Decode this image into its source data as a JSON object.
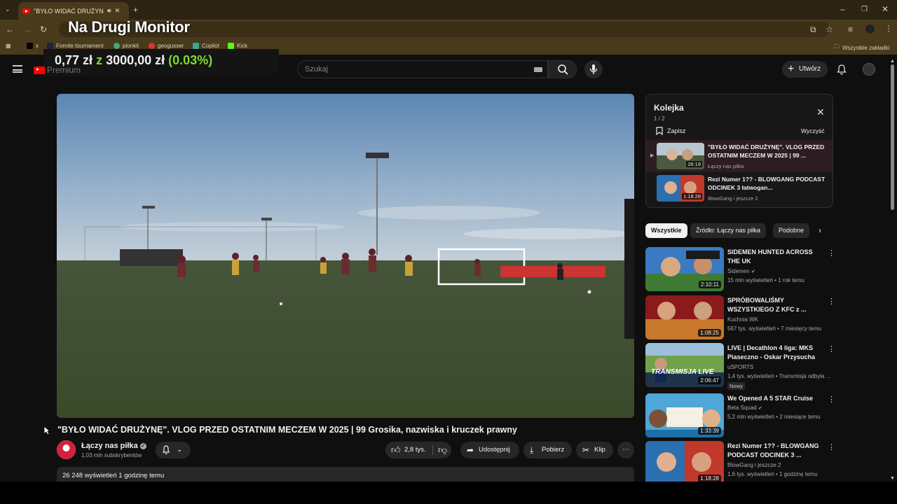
{
  "browser": {
    "tab_title": "\"BYŁO WIDAĆ DRUŻYNĘ\". V",
    "bookmarks": [
      "x",
      "Fornite tournament",
      "plonkit",
      "geogusser",
      "Copilot",
      "Kick"
    ],
    "all_bookmarks": "Wszystkie zakładki"
  },
  "overlay": {
    "title": "Na Drugi Monitor",
    "money_spent": "0,77 zł",
    "money_sep": "z",
    "money_total": "3000,00 zł",
    "money_pct": "(0.03%)"
  },
  "header": {
    "logo_text": "Premium",
    "search_placeholder": "Szukaj",
    "create_label": "Utwórz"
  },
  "video": {
    "title": "\"BYŁO WIDAĆ DRUŻYNĘ\". VLOG PRZED OSTATNIM MECZEM W 2025 | 99 Grosika, nazwiska i kruczek prawny",
    "channel": "Łączy nas piłka",
    "subscribers": "1,03 mln subskrybentów",
    "likes": "2,8 tys.",
    "share": "Udostępnij",
    "download": "Pobierz",
    "clip": "Klip",
    "views_time": "26 248 wyświetleń  1 godzinę temu"
  },
  "queue": {
    "title": "Kolejka",
    "count": "1 / 2",
    "save": "Zapisz",
    "clear": "Wyczyść",
    "items": [
      {
        "title": "\"BYŁO WIDAĆ DRUŻYNĘ\". VLOG PRZED OSTATNIM MECZEM W 2025 | 99 ...",
        "channel": "Łączy nas piłka",
        "duration": "26:19"
      },
      {
        "title": "Rezi Numer 1?? - BLOWGANG PODCAST ODCINEK 3 łatwogan...",
        "channel": "BlowGang i jeszcze 2",
        "duration": "1:18:28"
      }
    ]
  },
  "chips": [
    "Wszystkie",
    "Źródło: Łączy nas piłka",
    "Podobne"
  ],
  "recommendations": [
    {
      "title": "SIDEMEN HUNTED ACROSS THE UK",
      "channel": "Sidemen",
      "meta": "15 mln wyświetleń • 1 rok temu",
      "duration": "2:10:11",
      "badge": ""
    },
    {
      "title": "SPRÓBOWALIŚMY WSZYSTKIEGO Z KFC z ...",
      "channel": "Kuchnia WK",
      "meta": "567 tys. wyświetleń • 7 miesięcy temu",
      "duration": "1:08:25",
      "badge": ""
    },
    {
      "title": "LIVE | Decathlon 4 liga: MKS Piaseczno - Oskar Przysucha",
      "channel": "uSPORTS",
      "meta": "1,4 tys. wyświetleń • Transmisja odbyła ...",
      "duration": "2:06:47",
      "badge": "Nowy"
    },
    {
      "title": "We Opened A 5 STAR Cruise",
      "channel": "Beta Squad",
      "meta": "5,2 mln wyświetleń • 2 miesiące temu",
      "duration": "1:33:39",
      "badge": ""
    },
    {
      "title": "Rezi Numer 1?? - BLOWGANG PODCAST ODCINEK 3 ...",
      "channel": "BlowGang i jeszcze 2",
      "meta": "1,6 tys. wyświetleń • 1 godzinę temu",
      "duration": "1:18:28",
      "badge": ""
    }
  ],
  "thumb_texts": {
    "transmisja": "TRANSMISJA LIVE"
  },
  "colors": {
    "accent_green": "#7ddc2e",
    "youtube_red": "#ff0000",
    "chrome_bg": "#4a3a1c"
  }
}
